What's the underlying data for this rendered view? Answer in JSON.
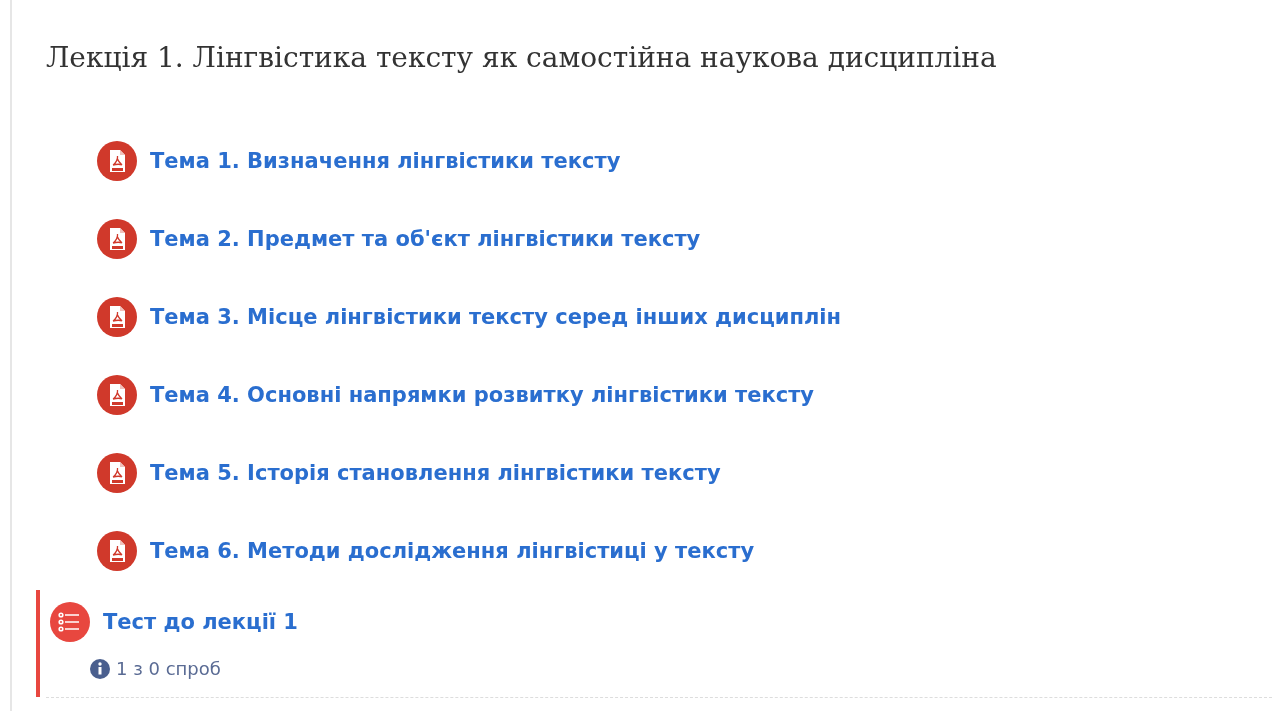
{
  "section": {
    "title": "Лекція 1. Лінгвістика тексту як самостійна наукова дисципліна",
    "activities": [
      {
        "kind": "pdf",
        "label": "Тема 1. Визначення лінгвістики тексту"
      },
      {
        "kind": "pdf",
        "label": "Тема 2. Предмет та об'єкт лінгвістики тексту"
      },
      {
        "kind": "pdf",
        "label": "Тема 3. Місце лінгвістики тексту серед інших дисциплін"
      },
      {
        "kind": "pdf",
        "label": "Тема 4. Основні напрямки розвитку лінгвістики тексту"
      },
      {
        "kind": "pdf",
        "label": "Тема 5. Історія становлення лінгвістики тексту"
      },
      {
        "kind": "pdf",
        "label": "Тема 6. Методи дослідження лінгвістиці у тексту"
      },
      {
        "kind": "quiz",
        "label": "Тест до лекції 1",
        "info": "1 з 0 спроб"
      }
    ]
  }
}
